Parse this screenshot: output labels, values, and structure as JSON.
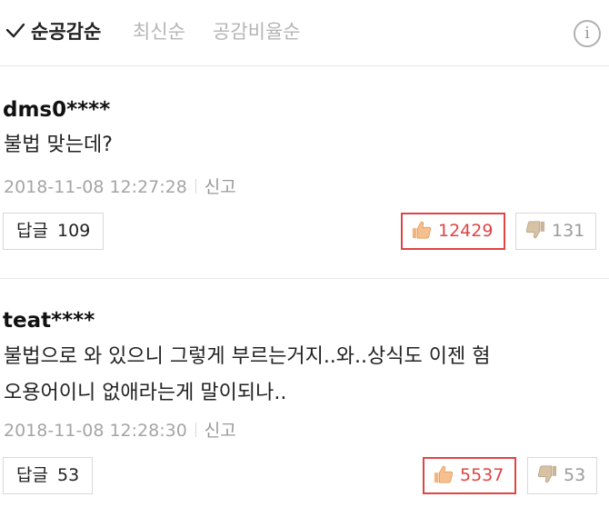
{
  "sort": {
    "options": [
      "순공감순",
      "최신순",
      "공감비율순"
    ],
    "selected": "순공감순"
  },
  "colors": {
    "accent": "#e04545",
    "muted": "#a5a5a5"
  },
  "icons": {
    "check": "check-icon",
    "info": "info-icon",
    "like": "thumbs-up-icon",
    "dislike": "thumbs-down-icon"
  },
  "comments": [
    {
      "author": "dms0****",
      "text": "불법 맞는데?",
      "date": "2018-11-08 12:27:28",
      "report_label": "신고",
      "reply_label": "답글",
      "reply_count": "109",
      "likes": "12429",
      "dislikes": "131"
    },
    {
      "author": "teat****",
      "text_line1": "불법으로 와 있으니 그렇게 부르는거지..와..상식도 이젠 혐",
      "text_line2": "오용어이니 없애라는게 말이되나..",
      "date": "2018-11-08 12:28:30",
      "report_label": "신고",
      "reply_label": "답글",
      "reply_count": "53",
      "likes": "5537",
      "dislikes": "53"
    }
  ]
}
